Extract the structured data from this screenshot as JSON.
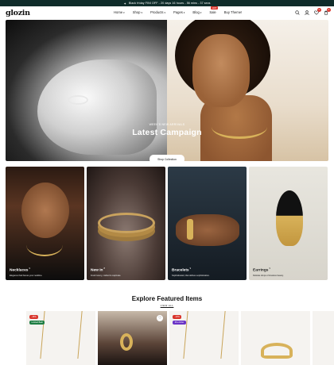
{
  "announcement": {
    "icon": "sparkle-icon",
    "text": "Black friday FINI OFF - 20 days 16 hours - 56 mins - 37 secs"
  },
  "header": {
    "logo": "glozin",
    "nav": [
      {
        "label": "Home",
        "has_dropdown": true
      },
      {
        "label": "Shop",
        "has_dropdown": true
      },
      {
        "label": "Products",
        "has_dropdown": true
      },
      {
        "label": "Pages",
        "has_dropdown": true
      },
      {
        "label": "Blog",
        "has_dropdown": true
      },
      {
        "label": "Sale",
        "badge": "HOT"
      },
      {
        "label": "Buy Theme!"
      }
    ],
    "icons": [
      "search-icon",
      "user-icon",
      "heart-icon",
      "cart-icon"
    ],
    "wishlist_count": "0",
    "cart_count": "0"
  },
  "hero": {
    "eyebrow": "WEEK'S NEW ARRIVALS",
    "title": "Latest Campaign",
    "button": "Shop Collection",
    "slides": 2,
    "active_slide": 1
  },
  "categories": [
    {
      "name": "Necklaces",
      "count": "9",
      "subtitle": "Elegance that frames your neckline."
    },
    {
      "name": "New In",
      "count": "8",
      "subtitle": "Fresh luxury, crafted to captivate."
    },
    {
      "name": "Bracelets",
      "count": "9",
      "subtitle": "Sophisticated, that defines sophistication."
    },
    {
      "name": "Earrings",
      "count": "9",
      "subtitle": "Delicate drops of timeless beauty."
    }
  ],
  "featured": {
    "title": "Explore Featured Items",
    "link": "VIEW ALL",
    "products": [
      {
        "badges": [
          "-15%",
          "Limited Badi"
        ]
      },
      {
        "badges": []
      },
      {
        "badges": [
          "-10%",
          "Pre-Order"
        ]
      },
      {
        "badges": []
      },
      {
        "badges": []
      }
    ]
  },
  "colors": {
    "topbar": "#0f2c2a",
    "sale": "#d9342b",
    "limited": "#1d7d43",
    "preorder": "#6a33c6",
    "gold": "#d8b25a"
  }
}
